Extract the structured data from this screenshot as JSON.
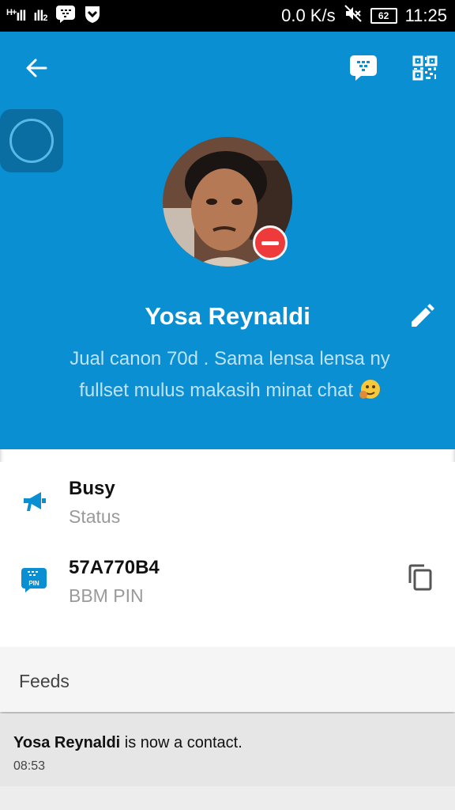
{
  "status_bar": {
    "network_left": "H+",
    "network_right": "2",
    "speed": "0.0 K/s",
    "battery": "62",
    "time": "11:25"
  },
  "header": {
    "profile_name": "Yosa Reynaldi",
    "personal_message": "Jual canon 70d . Sama lensa lensa ny fullset mulus makasih minat chat",
    "icons": [
      "back-arrow-icon",
      "bbm-chat-icon",
      "qr-code-icon",
      "edit-pencil-icon"
    ],
    "status_badge_color": "#ee3a3a",
    "accent_color": "#0a8fd3"
  },
  "info": {
    "status": {
      "title": "Busy",
      "label": "Status"
    },
    "pin": {
      "title": "57A770B4",
      "label": "BBM PIN",
      "icon_text": "PIN"
    }
  },
  "feeds": {
    "header": "Feeds",
    "items": [
      {
        "name": "Yosa Reynaldi",
        "text": "is now a contact.",
        "time": "08:53"
      }
    ]
  }
}
